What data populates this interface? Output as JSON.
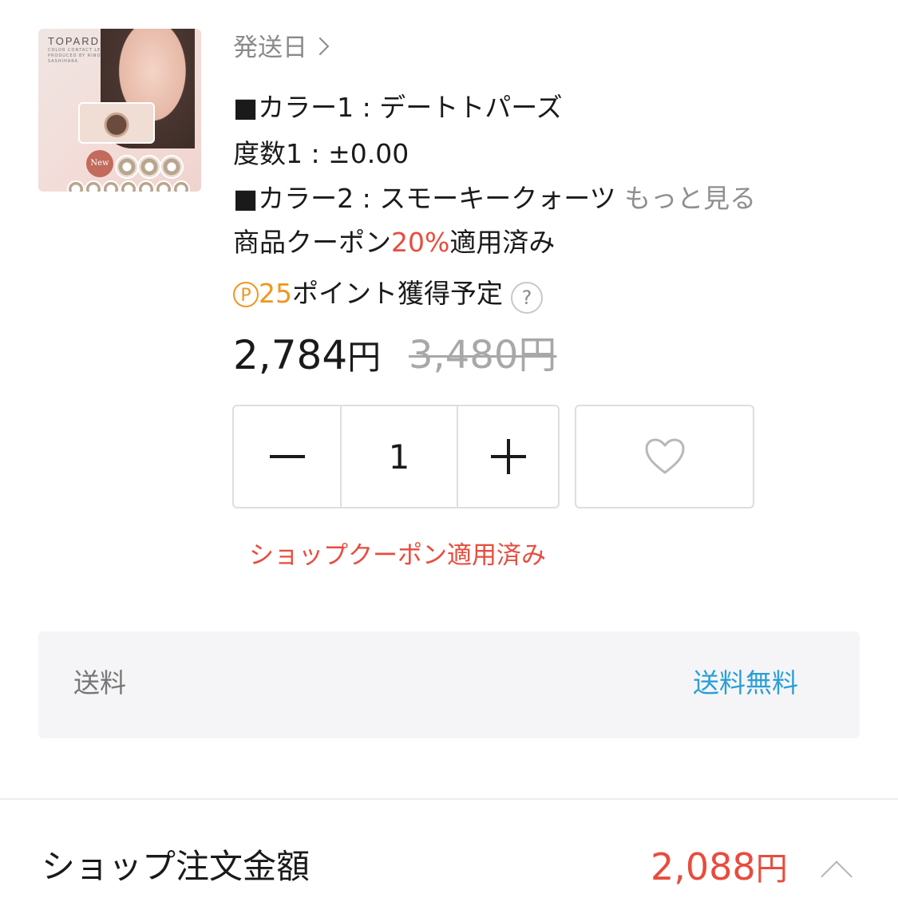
{
  "product": {
    "thumbnail_brand": "TOPARDS",
    "thumbnail_subtitle": "COLOR CONTACT LENSES PRODUCED BY RINO SASHIHARA",
    "thumbnail_badge": "New"
  },
  "shipping_date_link": "発送日",
  "options": {
    "color1": "■カラー1 : デートトパーズ",
    "power1": "度数1 : ±0.00",
    "color2": "■カラー2 : スモーキークォーツ",
    "more": "もっと見る"
  },
  "coupon_line": {
    "prefix": "商品クーポン",
    "percent": "20%",
    "suffix": "適用済み"
  },
  "points": {
    "icon_letter": "P",
    "value": "25",
    "label": "ポイント獲得予定",
    "help": "?"
  },
  "price": {
    "current": "2,784",
    "currency": "円",
    "original": "3,480円"
  },
  "quantity": "1",
  "shop_coupon_text": "ショップクーポン適用済み",
  "shipping": {
    "label": "送料",
    "value": "送料無料"
  },
  "shop_total": {
    "label": "ショップ注文金額",
    "amount": "2,088",
    "currency": "円"
  },
  "colors": {
    "accent_red": "#e84c3d",
    "point_orange": "#f0961e",
    "link_blue": "#2a9fd8"
  }
}
